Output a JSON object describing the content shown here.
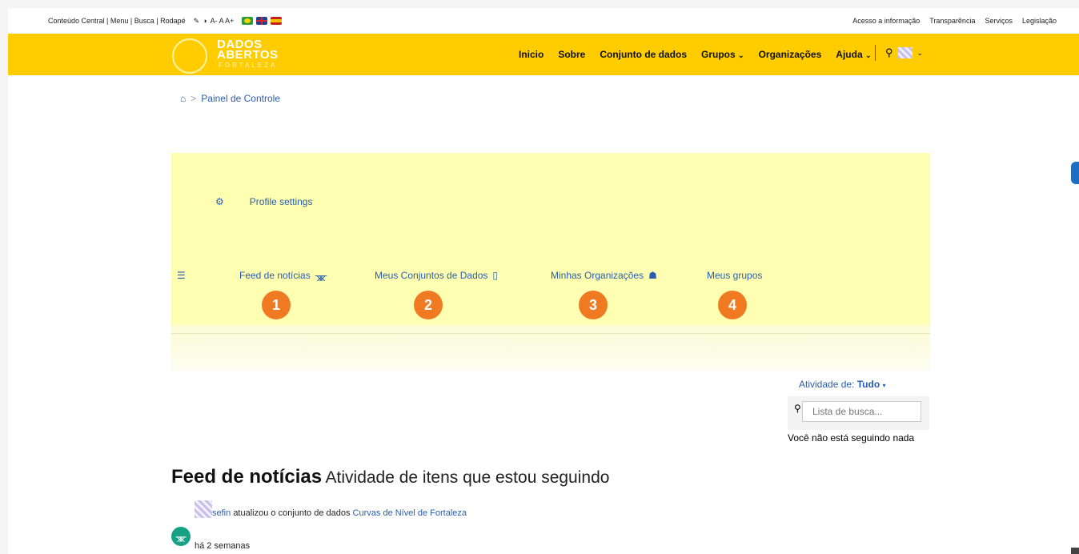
{
  "accessibility": {
    "skip_links": "Conteúdo Central | Menu | Busca | Rodapé",
    "contrast_icon": "contrast-icon",
    "font_controls": "A- A A+"
  },
  "top_links": [
    "Acesso a informação",
    "Transparência",
    "Serviços",
    "Legislação"
  ],
  "logo": {
    "line1": "DADOS",
    "line2": "ABERTOS",
    "line3": "FORTALEZA"
  },
  "nav": {
    "items": [
      "Inicio",
      "Sobre",
      "Conjunto de dados",
      "Grupos",
      "Organizações",
      "Ajuda"
    ],
    "dropdown_items": [
      "Grupos",
      "Ajuda"
    ],
    "search_icon": "search-icon"
  },
  "breadcrumb": {
    "home_icon": "home-icon",
    "separator": ">",
    "current": "Painel de Controle"
  },
  "dashboard": {
    "profile_settings": "Profile settings",
    "tabs": [
      {
        "label": "Feed de notícias",
        "icon": "sitemap-icon",
        "number": "1"
      },
      {
        "label": "Meus Conjuntos de Dados",
        "icon": "building-icon",
        "number": "2"
      },
      {
        "label": "Minhas Organizações",
        "icon": "users-icon",
        "number": "3"
      },
      {
        "label": "Meus grupos",
        "icon": "",
        "number": "4"
      }
    ]
  },
  "sidebar": {
    "activity_label": "Atividade de:",
    "activity_value": "Tudo",
    "search_placeholder": "Lista de busca...",
    "not_following": "Você não está seguindo nada"
  },
  "feed": {
    "title": "Feed de notícias",
    "subtitle": "Atividade de itens que estou seguindo",
    "items": [
      {
        "user": "sefin",
        "action": "atualizou o conjunto de dados",
        "dataset": "Curvas de Nível de Fortaleza",
        "time": "há 2 semanas"
      }
    ]
  },
  "colors": {
    "navbar": "#ffcc00",
    "dashboard_bg": "#feffb0",
    "link": "#2a5db0",
    "badge": "#f07a22",
    "activity_icon": "#16a085"
  }
}
